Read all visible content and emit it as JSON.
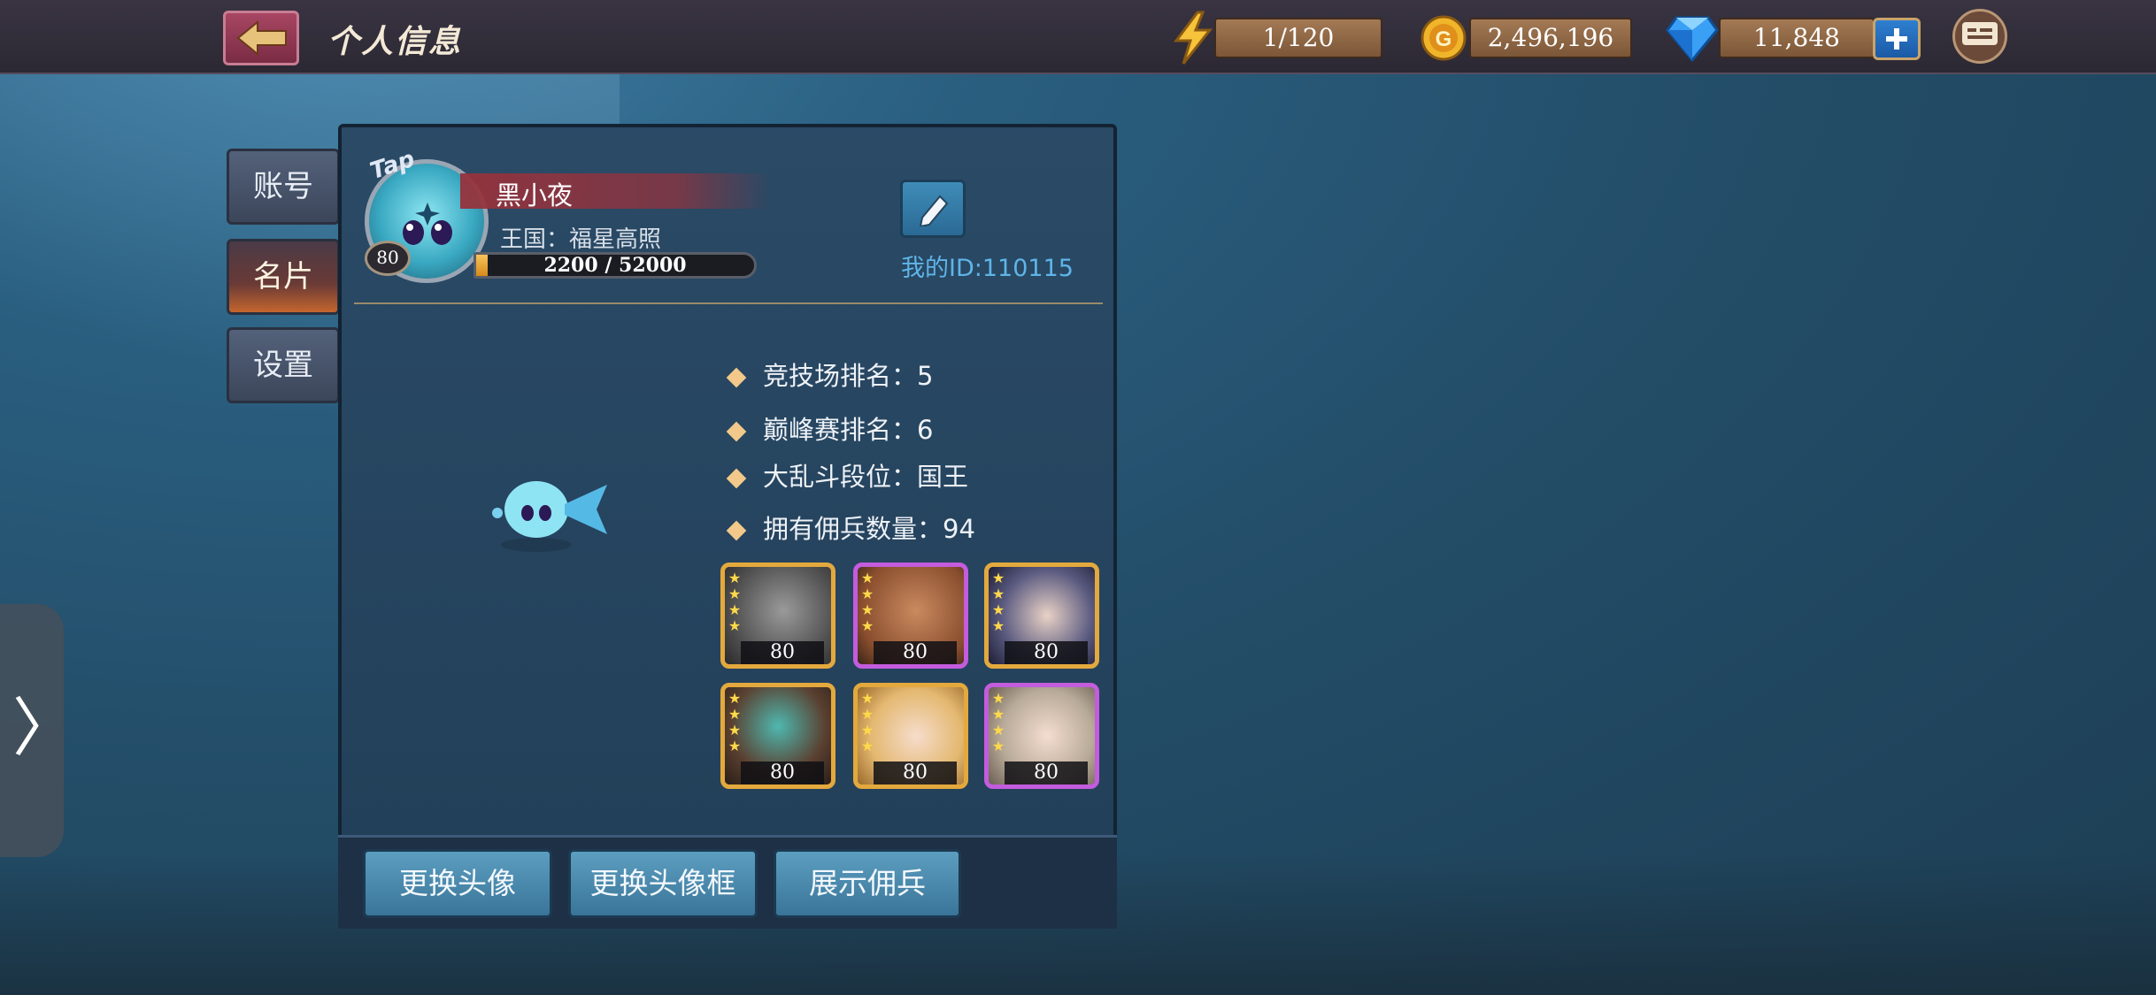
{
  "header": {
    "title": "个人信息",
    "energy": "1/120",
    "gold": "2,496,196",
    "gems": "11,848"
  },
  "tabs": [
    {
      "label": "账号"
    },
    {
      "label": "名片"
    },
    {
      "label": "设置"
    }
  ],
  "profile": {
    "avatar_badge": "Tap",
    "level": "80",
    "name": "黑小夜",
    "kingdom": "王国：福星高照",
    "exp_text": "2200 / 52000",
    "exp_fraction": 0.042,
    "id_text": "我的ID:110115"
  },
  "stats": [
    {
      "text": "竞技场排名：5"
    },
    {
      "text": "巅峰赛排名：6"
    },
    {
      "text": "大乱斗段位：国王"
    },
    {
      "text": "拥有佣兵数量：94"
    }
  ],
  "heroes": [
    {
      "level": "80",
      "frame": "gold"
    },
    {
      "level": "80",
      "frame": "purple"
    },
    {
      "level": "80",
      "frame": "gold"
    },
    {
      "level": "80",
      "frame": "gold"
    },
    {
      "level": "80",
      "frame": "gold"
    },
    {
      "level": "80",
      "frame": "purple"
    }
  ],
  "actions": {
    "change_avatar": "更换头像",
    "change_frame": "更换头像框",
    "show_mercenary": "展示佣兵"
  },
  "side_handle": "〉",
  "colors": {
    "accent_gold": "#e3a93d",
    "accent_purple": "#c35cdd",
    "id_blue": "#5fb5e8"
  }
}
